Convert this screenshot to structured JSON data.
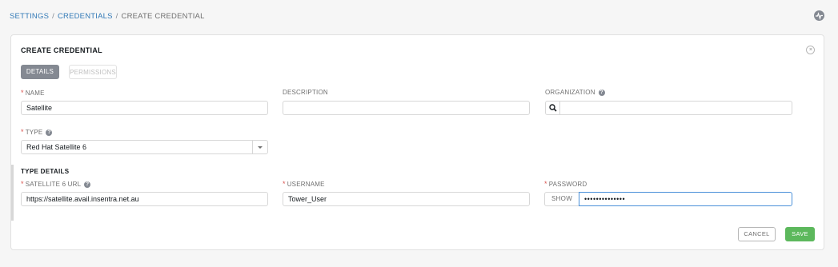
{
  "breadcrumb": {
    "items": [
      {
        "label": "SETTINGS"
      },
      {
        "label": "CREDENTIALS"
      }
    ],
    "separator": "/",
    "current": "CREATE CREDENTIAL"
  },
  "panel": {
    "title": "CREATE CREDENTIAL",
    "tabs": [
      {
        "label": "DETAILS",
        "active": true
      },
      {
        "label": "PERMISSIONS",
        "active": false
      }
    ]
  },
  "fields": {
    "name": {
      "label": "NAME",
      "required": true,
      "value": "Satellite"
    },
    "description": {
      "label": "DESCRIPTION",
      "required": false,
      "value": ""
    },
    "organization": {
      "label": "ORGANIZATION",
      "required": false,
      "value": ""
    },
    "type": {
      "label": "TYPE",
      "required": true,
      "value": "Red Hat Satellite 6"
    }
  },
  "type_details": {
    "title": "TYPE DETAILS",
    "satellite_url": {
      "label": "SATELLITE 6 URL",
      "required": true,
      "value": "https://satellite.avail.insentra.net.au"
    },
    "username": {
      "label": "USERNAME",
      "required": true,
      "value": "Tower_User"
    },
    "password": {
      "label": "PASSWORD",
      "required": true,
      "value": "••••••••••••••",
      "show_label": "SHOW"
    }
  },
  "actions": {
    "cancel_label": "CANCEL",
    "save_label": "SAVE"
  },
  "colors": {
    "link": "#337ab7",
    "save": "#5cb85c",
    "active_tab": "#848992",
    "required": "#d9534f",
    "focus_border": "#4a90d9"
  },
  "icons": [
    "activity-stream-icon",
    "close-icon",
    "help-icon",
    "search-icon",
    "chevron-down-icon"
  ]
}
